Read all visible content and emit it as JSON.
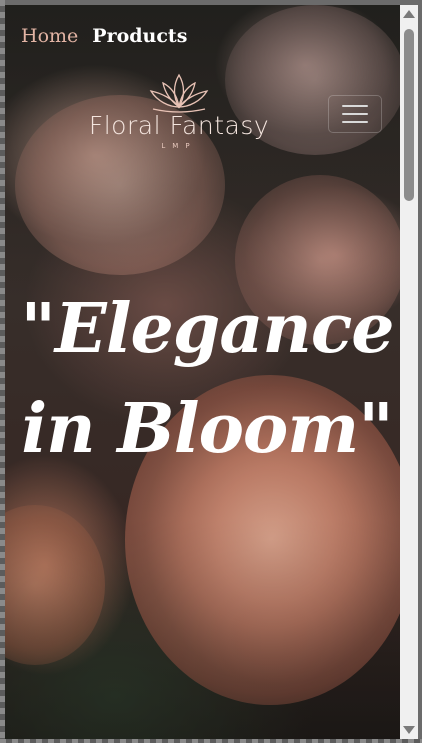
{
  "nav": {
    "home_label": "Home",
    "products_label": "Products"
  },
  "logo": {
    "icon": "lotus-icon",
    "brand_name": "Floral Fantasy",
    "brand_sub": "LMP"
  },
  "menu_toggle_icon": "hamburger-icon",
  "hero": {
    "line1": "\"Elegance",
    "line2": "in Bloom\""
  },
  "colors": {
    "nav_active": "#e2b4a4",
    "logo_text": "#f4e5de",
    "hero_text": "#ffffff"
  }
}
